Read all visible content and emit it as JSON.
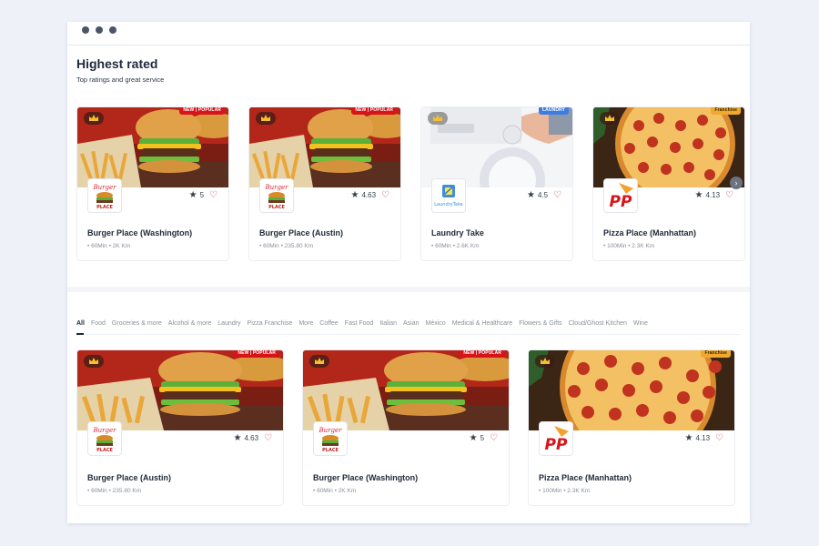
{
  "window": {
    "dots": [
      "•",
      "•",
      "•"
    ]
  },
  "highest_rated": {
    "title": "Highest rated",
    "subtitle": "Top ratings and great service",
    "cards": [
      {
        "name": "Burger Place (Washington)",
        "meta": "• 60Min • 2K Km",
        "rating": "5",
        "badge": "NEW | POPULAR",
        "logo": "burger-place-logo",
        "image": "burger-image"
      },
      {
        "name": "Burger Place (Austin)",
        "meta": "• 60Min • 235.80 Km",
        "rating": "4.63",
        "badge": "NEW | POPULAR",
        "logo": "burger-place-logo",
        "image": "burger-image"
      },
      {
        "name": "Laundry Take",
        "meta": "• 60Min • 2.6K Km",
        "rating": "4.5",
        "badge": "LAUNDRY",
        "logo": "laundry-take-logo",
        "logo_text": "LaundryTake",
        "image": "laundry-image"
      },
      {
        "name": "Pizza Place (Manhattan)",
        "meta": "• 100Min • 2.3K Km",
        "rating": "4.13",
        "badge": "Franchise",
        "logo": "pizza-place-logo",
        "logo_text": "PP",
        "image": "pizza-image"
      }
    ],
    "next_icon": "›"
  },
  "categories": {
    "tabs": [
      "All",
      "Food",
      "Groceries & more",
      "Alcohol & more",
      "Laundry",
      "Pizza Franchise",
      "More",
      "Coffee",
      "Fast Food",
      "Italian",
      "Asian",
      "México",
      "Medical & Healthcare",
      "Flowers & Gifts",
      "Cloud/Ghost Kitchen",
      "Wine"
    ],
    "active": "All"
  },
  "listing": {
    "cards": [
      {
        "name": "Burger Place (Austin)",
        "meta": "• 60Min • 235.80 Km",
        "rating": "4.63",
        "badge": "NEW | POPULAR",
        "logo": "burger-place-logo",
        "image": "burger-image"
      },
      {
        "name": "Burger Place (Washington)",
        "meta": "• 60Min • 2K Km",
        "rating": "5",
        "badge": "NEW | POPULAR",
        "logo": "burger-place-logo",
        "image": "burger-image"
      },
      {
        "name": "Pizza Place (Manhattan)",
        "meta": "• 100Min • 2.3K Km",
        "rating": "4.13",
        "badge": "Franchise",
        "logo": "pizza-place-logo",
        "logo_text": "PP",
        "image": "pizza-image"
      }
    ]
  },
  "icons": {
    "star": "★",
    "heart": "♡",
    "crown": "crown-icon"
  },
  "colors": {
    "popular_badge": "#d7141a",
    "laundry_badge": "#3d7de0",
    "franchise_badge": "#f0a92e",
    "heart": "#d7263d"
  },
  "logo_texts": {
    "burger_top": "Burger",
    "burger_bottom": "PLACE"
  }
}
